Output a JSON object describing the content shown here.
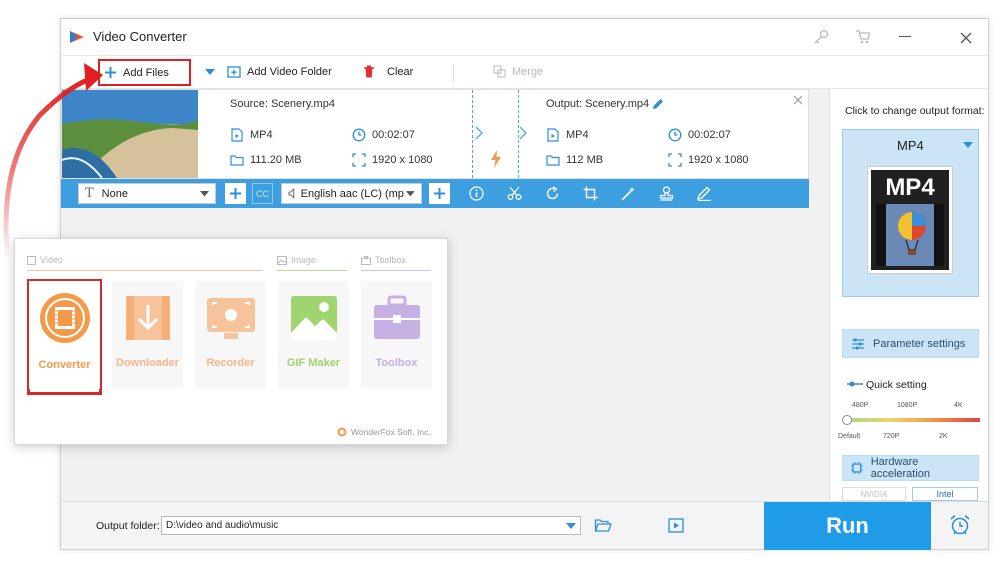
{
  "window": {
    "title": "Video Converter"
  },
  "toolbar": {
    "add_files": "Add Files",
    "add_folder": "Add Video Folder",
    "clear": "Clear",
    "merge": "Merge"
  },
  "file": {
    "source_label": "Source: Scenery.mp4",
    "output_label": "Output: Scenery.mp4",
    "src_format": "MP4",
    "src_duration": "00:02:07",
    "src_size": "111.20 MB",
    "src_resolution": "1920 x 1080",
    "out_format": "MP4",
    "out_duration": "00:02:07",
    "out_size": "112 MB",
    "out_resolution": "1920 x 1080"
  },
  "actionbar": {
    "subtitle": "None",
    "audio": "English aac (LC) (mp"
  },
  "rightpanel": {
    "hint": "Click to change output format:",
    "format": "MP4",
    "format_thumb_text": "MP4",
    "param_settings": "Parameter settings",
    "quick_setting": "Quick setting",
    "ticks_top": [
      "480P",
      "1080P",
      "4K"
    ],
    "ticks_bottom": [
      "Default",
      "720P",
      "2K"
    ],
    "quick_setting_value": "Default",
    "hw_accel": "Hardware acceleration",
    "nvidia": "NVIDIA",
    "intel": "Intel"
  },
  "bottom": {
    "output_folder_label": "Output folder:",
    "output_path": "D:\\video and audio\\music",
    "run": "Run"
  },
  "popup": {
    "tabs": [
      "Video",
      "Image",
      "Toolbox"
    ],
    "tiles": [
      "Converter",
      "Downloader",
      "Recorder",
      "GIF Maker",
      "Toolbox"
    ],
    "brand": "WonderFox Soft, Inc."
  },
  "colors": {
    "accent_blue": "#1f9be8",
    "highlight_red": "#e02020",
    "orange": "#f39a4a",
    "green": "#7cc24a",
    "purple": "#a889d1"
  }
}
